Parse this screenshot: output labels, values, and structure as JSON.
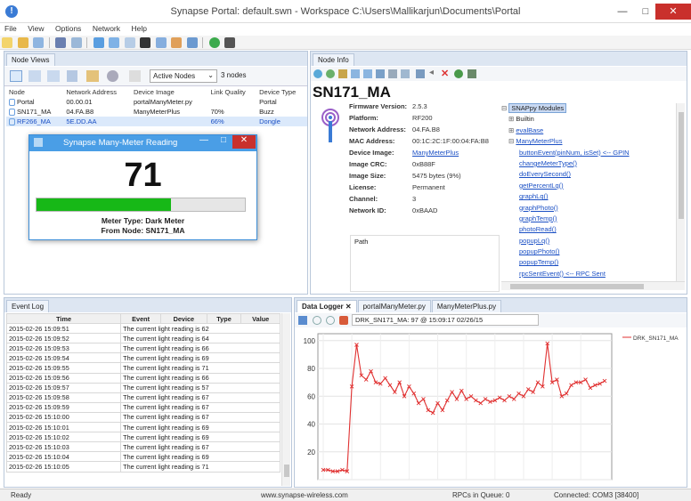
{
  "window": {
    "title": "Synapse Portal: default.swn - Workspace C:\\Users\\Mallikarjun\\Documents\\Portal",
    "icon_name": "synapse-app-icon"
  },
  "menu": [
    "File",
    "View",
    "Options",
    "Network",
    "Help"
  ],
  "node_views": {
    "tab": "Node Views",
    "filter_selected": "Active Nodes",
    "node_count": "3 nodes",
    "columns": [
      "Node",
      "Network Address",
      "Device Image",
      "Link Quality",
      "Device Type"
    ],
    "rows": [
      {
        "node": "Portal",
        "address": "00.00.01",
        "image": "portalManyMeter.py",
        "quality": "",
        "type": "Portal",
        "color": "#222222"
      },
      {
        "node": "SN171_MA",
        "address": "04.FA.B8",
        "image": "ManyMeterPlus",
        "quality": "70%",
        "type": "Buzz",
        "color": "#222222"
      },
      {
        "node": "RF266_MA",
        "address": "5E.DD.AA",
        "image": "",
        "quality": "66%",
        "type": "Dongle",
        "color": "#1a4fc4"
      }
    ]
  },
  "meter_window": {
    "title": "Synapse Many-Meter Reading",
    "reading": "71",
    "level_percent": 71,
    "meter_type": "Meter Type: Dark Meter",
    "from_node": "From Node: SN171_MA"
  },
  "node_info": {
    "tab": "Node Info",
    "node_name": "SN171_MA",
    "fields": [
      {
        "k": "Firmware Version:",
        "v": "2.5.3",
        "link": false
      },
      {
        "k": "Platform:",
        "v": "RF200",
        "link": false
      },
      {
        "k": "Network Address:",
        "v": "04.FA.B8",
        "link": false
      },
      {
        "k": "MAC Address:",
        "v": "00:1C:2C:1F:00:04:FA:B8",
        "link": false
      },
      {
        "k": "Device Image:",
        "v": "ManyMeterPlus",
        "link": true
      },
      {
        "k": "Image CRC:",
        "v": "0xB88F",
        "link": false
      },
      {
        "k": "Image Size:",
        "v": "5475 bytes (9%)",
        "link": false
      },
      {
        "k": "License:",
        "v": "Permanent",
        "link": false
      },
      {
        "k": "Channel:",
        "v": "3",
        "link": false
      },
      {
        "k": "Network ID:",
        "v": "0xBAAD",
        "link": false
      }
    ],
    "path_label": "Path",
    "tree_root": "SNAPpy Modules",
    "tree_groups": [
      "Builtin",
      "evalBase",
      "ManyMeterPlus"
    ],
    "functions": [
      "buttonEvent(pinNum, isSet) <-- GPIN",
      "changeMeterType()",
      "doEverySecond()",
      "getPercentLq()",
      "graphLq()",
      "graphPhoto()",
      "graphTemp()",
      "photoRead()",
      "popupLq()",
      "popupPhoto()",
      "popupTemp()",
      "rpcSentEvent() <-- RPC Sent"
    ]
  },
  "event_log": {
    "tab": "Event Log",
    "columns": [
      "Time",
      "Event",
      "Device",
      "Type",
      "Value"
    ],
    "rows": [
      [
        "2015-02-26 15:09:51",
        "The current light reading is 62"
      ],
      [
        "2015-02-26 15:09:52",
        "The current light reading is 64"
      ],
      [
        "2015-02-26 15:09:53",
        "The current light reading is 66"
      ],
      [
        "2015-02-26 15:09:54",
        "The current light reading is 69"
      ],
      [
        "2015-02-26 15:09:55",
        "The current light reading is 71"
      ],
      [
        "2015-02-26 15:09:56",
        "The current light reading is 66"
      ],
      [
        "2015-02-26 15:09:57",
        "The current light reading is 57"
      ],
      [
        "2015-02-26 15:09:58",
        "The current light reading is 67"
      ],
      [
        "2015-02-26 15:09:59",
        "The current light reading is 67"
      ],
      [
        "2015-02-26 15:10:00",
        "The current light reading is 67"
      ],
      [
        "2015-02-26 15:10:01",
        "The current light reading is 69"
      ],
      [
        "2015-02-26 15:10:02",
        "The current light reading is 69"
      ],
      [
        "2015-02-26 15:10:03",
        "The current light reading is 67"
      ],
      [
        "2015-02-26 15:10:04",
        "The current light reading is 69"
      ],
      [
        "2015-02-26 15:10:05",
        "The current light reading is 71"
      ]
    ]
  },
  "data_logger": {
    "tabs": [
      "Data Logger",
      "portalManyMeter.py",
      "ManyMeterPlus.py"
    ],
    "readout": "DRK_SN171_MA: 97 @ 15:09:17 02/26/15"
  },
  "chart_data": {
    "type": "line",
    "title": "",
    "xlabel": "",
    "ylabel": "",
    "ylim": [
      0,
      105
    ],
    "yticks": [
      0,
      20,
      40,
      60,
      80,
      100
    ],
    "grid": true,
    "legend_position": "top-right",
    "series": [
      {
        "name": "DRK_SN171_MA",
        "color": "#e03030",
        "values": [
          7,
          7,
          6,
          6,
          7,
          6,
          67,
          97,
          75,
          72,
          78,
          70,
          69,
          73,
          68,
          63,
          70,
          60,
          67,
          62,
          55,
          58,
          50,
          48,
          55,
          50,
          57,
          63,
          58,
          64,
          58,
          60,
          57,
          55,
          58,
          56,
          57,
          59,
          57,
          60,
          58,
          62,
          60,
          65,
          63,
          70,
          67,
          98,
          70,
          72,
          60,
          62,
          68,
          70,
          70,
          72,
          66,
          68,
          69,
          71
        ]
      }
    ]
  },
  "status": {
    "left": "Ready",
    "center": "www.synapse-wireless.com",
    "rpcs": "RPCs in Queue: 0",
    "connection": "Connected: COM3 [38400]"
  }
}
